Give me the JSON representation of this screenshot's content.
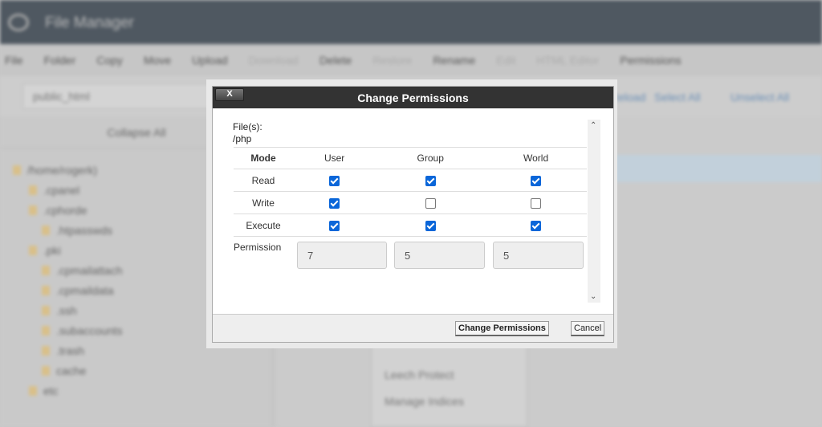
{
  "app": {
    "title": "File Manager"
  },
  "toolbar": [
    "File",
    "Folder",
    "Copy",
    "Move",
    "Upload",
    "Download",
    "Delete",
    "Restore",
    "Rename",
    "Edit",
    "HTML Editor",
    "Permissions"
  ],
  "toolbar_disabled": [
    false,
    false,
    false,
    false,
    false,
    true,
    false,
    true,
    false,
    true,
    true,
    false
  ],
  "path": {
    "value": "public_html"
  },
  "links": [
    "Reload",
    "Select All",
    "Unselect All"
  ],
  "sidebar": {
    "collapse": "Collapse All",
    "tree": [
      "/home/rogerk)",
      ".cpanel",
      ".cphorde",
      ".htpasswds",
      ".pki",
      ".cpmailattach",
      ".cpmaildata",
      ".ssh",
      ".subaccounts",
      ".trash",
      "cache",
      "etc"
    ]
  },
  "context_menu": [
    "Leech Protect",
    "Manage Indices"
  ],
  "dialog": {
    "title": "Change Permissions",
    "close": "X",
    "files_label": "File(s):",
    "files_value": "/php",
    "headers": [
      "Mode",
      "User",
      "Group",
      "World"
    ],
    "rows": [
      {
        "label": "Read",
        "checked": [
          true,
          true,
          true
        ]
      },
      {
        "label": "Write",
        "checked": [
          true,
          false,
          false
        ]
      },
      {
        "label": "Execute",
        "checked": [
          true,
          true,
          true
        ]
      }
    ],
    "permission_label": "Permission",
    "permission_values": [
      "7",
      "5",
      "5"
    ],
    "submit": "Change Permissions",
    "cancel": "Cancel",
    "checkbox_color": "#0a66d9"
  }
}
